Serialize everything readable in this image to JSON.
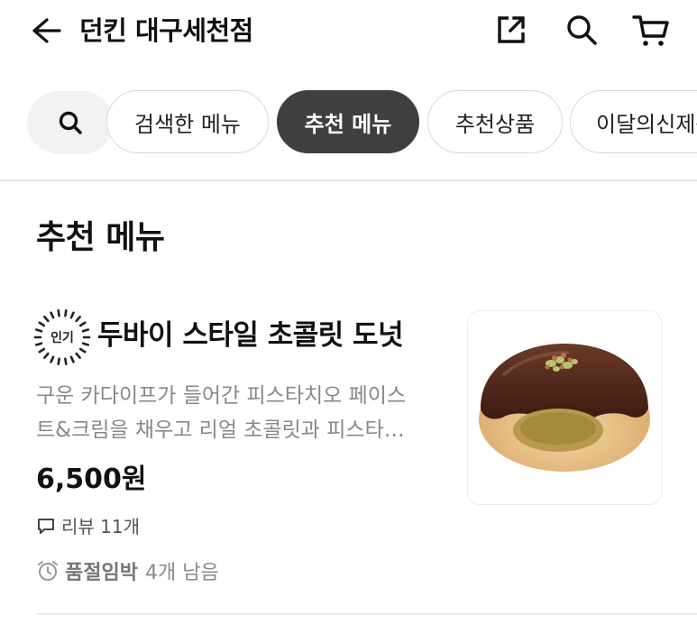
{
  "header": {
    "title": "던킨 대구세천점"
  },
  "chips": {
    "searched": "검색한 메뉴",
    "recommended": "추천 메뉴",
    "recommended_products": "추천상품",
    "this_month": "이달의신제품"
  },
  "section": {
    "title": "추천 메뉴"
  },
  "item": {
    "badge": "인기",
    "name": "두바이 스타일 초콜릿 도넛",
    "description_line1": "구운 카다이프가 들어간 피스타치오 페이스",
    "description_line2": "트&크림을 채우고 리얼 초콜릿과 피스타…",
    "price": "6,500원",
    "review": "리뷰 11개",
    "soldout_label": "품절임박",
    "soldout_count": "4개 남음"
  }
}
